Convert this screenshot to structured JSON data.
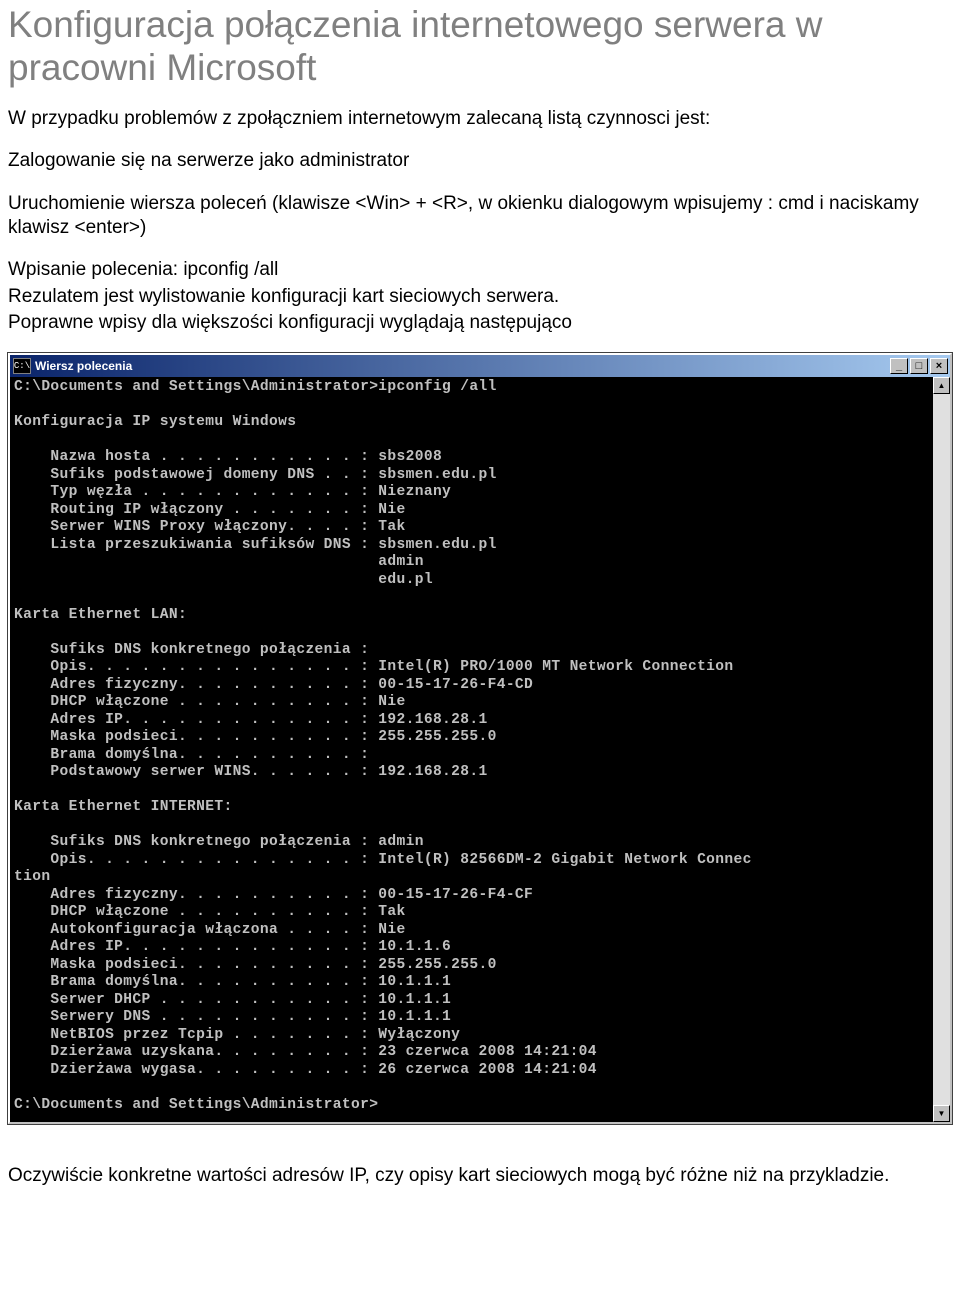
{
  "heading": "Konfiguracja połączenia internetowego serwera w pracowni Microsoft",
  "intro": "W przypadku problemów z zpołączniem internetowym zalecaną listą czynnosci jest:",
  "step1": "Zalogowanie się na serwerze jako administrator",
  "step2": "Uruchomienie wiersza poleceń (klawisze <Win> + <R>, w okienku dialogowym wpisujemy : cmd i naciskamy klawisz <enter>)",
  "step3a": "Wpisanie polecenia: ipconfig /all",
  "step3b": "Rezulatem jest wylistowanie konfiguracji kart sieciowych serwera.",
  "step3c": "Poprawne wpisy dla większości konfiguracji wyglądają następująco",
  "cmd": {
    "icon_text": "C:\\",
    "title": "Wiersz polecenia",
    "buttons": {
      "min": "_",
      "max": "□",
      "close": "×"
    },
    "scroll": {
      "up": "▲",
      "down": "▼"
    },
    "output": "C:\\Documents and Settings\\Administrator>ipconfig /all\n\nKonfiguracja IP systemu Windows\n\n    Nazwa hosta . . . . . . . . . . . : sbs2008\n    Sufiks podstawowej domeny DNS . . : sbsmen.edu.pl\n    Typ węzła . . . . . . . . . . . . : Nieznany\n    Routing IP włączony . . . . . . . : Nie\n    Serwer WINS Proxy włączony. . . . : Tak\n    Lista przeszukiwania sufiksów DNS : sbsmen.edu.pl\n                                        admin\n                                        edu.pl\n\nKarta Ethernet LAN:\n\n    Sufiks DNS konkretnego połączenia :\n    Opis. . . . . . . . . . . . . . . : Intel(R) PRO/1000 MT Network Connection\n    Adres fizyczny. . . . . . . . . . : 00-15-17-26-F4-CD\n    DHCP włączone . . . . . . . . . . : Nie\n    Adres IP. . . . . . . . . . . . . : 192.168.28.1\n    Maska podsieci. . . . . . . . . . : 255.255.255.0\n    Brama domyślna. . . . . . . . . . :\n    Podstawowy serwer WINS. . . . . . : 192.168.28.1\n\nKarta Ethernet INTERNET:\n\n    Sufiks DNS konkretnego połączenia : admin\n    Opis. . . . . . . . . . . . . . . : Intel(R) 82566DM-2 Gigabit Network Connec\ntion\n    Adres fizyczny. . . . . . . . . . : 00-15-17-26-F4-CF\n    DHCP włączone . . . . . . . . . . : Tak\n    Autokonfiguracja włączona . . . . : Nie\n    Adres IP. . . . . . . . . . . . . : 10.1.1.6\n    Maska podsieci. . . . . . . . . . : 255.255.255.0\n    Brama domyślna. . . . . . . . . . : 10.1.1.1\n    Serwer DHCP . . . . . . . . . . . : 10.1.1.1\n    Serwery DNS . . . . . . . . . . . : 10.1.1.1\n    NetBIOS przez Tcpip . . . . . . . : Wyłączony\n    Dzierżawa uzyskana. . . . . . . . : 23 czerwca 2008 14:21:04\n    Dzierżawa wygasa. . . . . . . . . : 26 czerwca 2008 14:21:04\n\nC:\\Documents and Settings\\Administrator>"
  },
  "footer": "Oczywiście konkretne wartości adresów IP, czy opisy kart sieciowych mogą być różne niż na przykladzie."
}
